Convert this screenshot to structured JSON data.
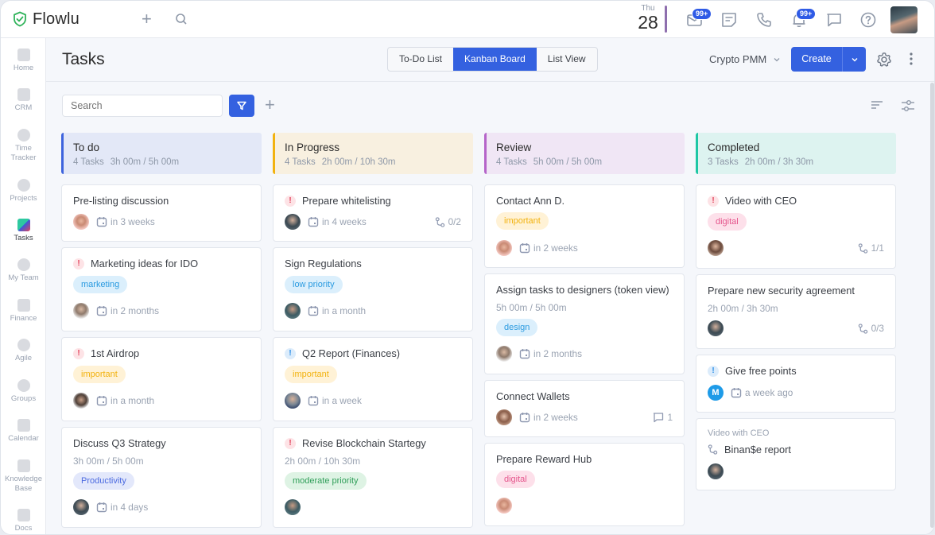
{
  "app": {
    "name": "Flowlu"
  },
  "topbar": {
    "date": {
      "weekday": "Thu",
      "day": "28"
    },
    "mail_badge": "99+",
    "notifications_badge": "99+"
  },
  "sidebar": {
    "items": [
      {
        "label": "Home"
      },
      {
        "label": "CRM"
      },
      {
        "label": "Time Tracker"
      },
      {
        "label": "Projects"
      },
      {
        "label": "Tasks",
        "active": true
      },
      {
        "label": "My Team"
      },
      {
        "label": "Finance"
      },
      {
        "label": "Agile"
      },
      {
        "label": "Groups"
      },
      {
        "label": "Calendar"
      },
      {
        "label": "Knowledge Base"
      },
      {
        "label": "Docs"
      }
    ]
  },
  "header": {
    "title": "Tasks",
    "views": [
      {
        "label": "To-Do List"
      },
      {
        "label": "Kanban Board",
        "active": true
      },
      {
        "label": "List View"
      }
    ],
    "project": "Crypto PMM",
    "create_label": "Create"
  },
  "toolbar": {
    "search_placeholder": "Search"
  },
  "colors": {
    "accent": "#3461e0",
    "todo": "#3d63dd",
    "progress": "#f2b20f",
    "review": "#b565c9",
    "completed": "#1fc7a5"
  },
  "columns": [
    {
      "title": "To do",
      "count": "4 Tasks",
      "time": "3h 00m / 5h 00m",
      "cards": [
        {
          "title": "Pre-listing discussion",
          "due": "in 3 weeks"
        },
        {
          "title": "Marketing ideas for IDO",
          "priority": "high",
          "tag": "marketing",
          "due": "in 2 months"
        },
        {
          "title": "1st Airdrop",
          "priority": "high",
          "tag": "important",
          "due": "in a month"
        },
        {
          "title": "Discuss Q3 Strategy",
          "time": "3h 00m / 5h 00m",
          "tag": "Productivity",
          "due": "in 4 days"
        }
      ]
    },
    {
      "title": "In Progress",
      "count": "4 Tasks",
      "time": "2h 00m / 10h 30m",
      "cards": [
        {
          "title": "Prepare whitelisting",
          "priority": "high",
          "due": "in 4 weeks",
          "subtasks": "0/2"
        },
        {
          "title": "Sign Regulations",
          "tag": "low priority",
          "due": "in a month"
        },
        {
          "title": "Q2 Report (Finances)",
          "priority": "low",
          "tag": "important",
          "due": "in a week"
        },
        {
          "title": "Revise Blockchain Startegy",
          "priority": "high",
          "time": "2h 00m / 10h 30m",
          "tag": "moderate priority"
        }
      ]
    },
    {
      "title": "Review",
      "count": "4 Tasks",
      "time": "5h 00m / 5h 00m",
      "cards": [
        {
          "title": "Contact Ann D.",
          "tag": "important",
          "due": "in 2 weeks"
        },
        {
          "title": "Assign tasks to designers (token view)",
          "time": "5h 00m / 5h 00m",
          "tag": "design",
          "due": "in 2 months"
        },
        {
          "title": "Connect Wallets",
          "due": "in 2 weeks",
          "comments": "1"
        },
        {
          "title": "Prepare Reward Hub",
          "tag": "digital"
        }
      ]
    },
    {
      "title": "Completed",
      "count": "3 Tasks",
      "time": "2h 00m / 3h 30m",
      "cards": [
        {
          "title": "Video with CEO",
          "priority": "high",
          "tag": "digital",
          "subtasks": "1/1"
        },
        {
          "title": "Prepare new security agreement",
          "time": "2h 00m / 3h 30m",
          "subtasks": "0/3"
        },
        {
          "title": "Give free points",
          "priority": "low",
          "avatar_initial": "M",
          "due": "a week ago"
        },
        {
          "parent": "Video with CEO",
          "title": "Binan$e report"
        }
      ]
    }
  ]
}
